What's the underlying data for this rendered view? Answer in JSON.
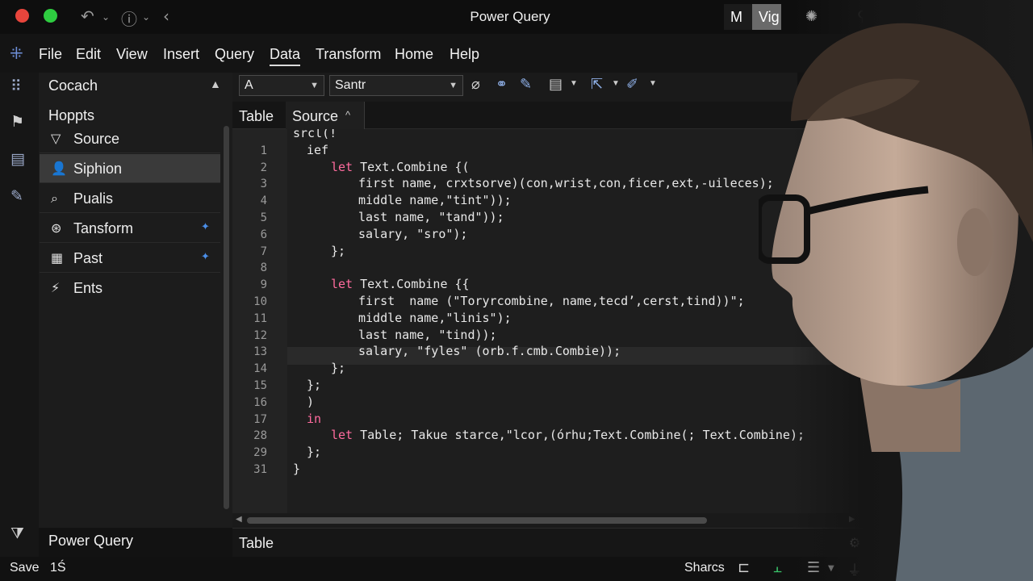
{
  "titlebar": {
    "title": "Power Query",
    "mode_m": "M",
    "mode_v": "Vig"
  },
  "menu": {
    "items": [
      "File",
      "Edit",
      "View",
      "Insert",
      "Query",
      "Data",
      "Transform",
      "Home",
      "Help"
    ],
    "active": "Data"
  },
  "left_panel": {
    "header": "Cocach",
    "subheader": "Hoppts",
    "items": [
      {
        "label": "Source",
        "icon": "filter-icon"
      },
      {
        "label": "Siphion",
        "icon": "user-icon",
        "selected": true
      },
      {
        "label": "Pualis",
        "icon": "search-icon"
      },
      {
        "label": "Tansform",
        "icon": "transform-icon",
        "pinned": true
      },
      {
        "label": "Past",
        "icon": "table-icon",
        "pinned": true
      },
      {
        "label": "Ents",
        "icon": "wand-icon"
      }
    ],
    "footer": "Power Query"
  },
  "toolbar": {
    "font_select": "A",
    "style_select": "Santr"
  },
  "tabs": {
    "table": "Table",
    "source": "Source"
  },
  "editor": {
    "lines": [
      {
        "n": "",
        "indent": 0,
        "text": "srcl(!"
      },
      {
        "n": "1",
        "indent": 1,
        "text": "ief"
      },
      {
        "n": "2",
        "indent": 2,
        "kw": "let",
        "text": " Text.Combine {("
      },
      {
        "n": "3",
        "indent": 3,
        "text": "first name, crxtsorve)(con,wrist,con,ficer,ext,-uileces);"
      },
      {
        "n": "4",
        "indent": 3,
        "text": "middle name,\"tint\"));"
      },
      {
        "n": "5",
        "indent": 3,
        "text": "last name, \"tand\"));"
      },
      {
        "n": "6",
        "indent": 3,
        "text": "salary, \"sro\");"
      },
      {
        "n": "7",
        "indent": 2,
        "text": "};"
      },
      {
        "n": "8",
        "indent": 0,
        "text": ""
      },
      {
        "n": "9",
        "indent": 2,
        "kw": "let",
        "text": " Text.Combine {{"
      },
      {
        "n": "10",
        "indent": 3,
        "text": "first  name (\"Toryrcombine, name,tecd’,cerst,tind))\";"
      },
      {
        "n": "11",
        "indent": 3,
        "text": "middle name,\"linis\");"
      },
      {
        "n": "12",
        "indent": 3,
        "text": "last name, \"tind));"
      },
      {
        "n": "13",
        "indent": 3,
        "text": "salary, \"fyles\" (orb.f.cmb.Combie));"
      },
      {
        "n": "14",
        "indent": 2,
        "text": "};"
      },
      {
        "n": "15",
        "indent": 1,
        "text": "};"
      },
      {
        "n": "16",
        "indent": 1,
        "text": ")"
      },
      {
        "n": "17",
        "indent": 1,
        "kw": "in",
        "text": ""
      },
      {
        "n": "28",
        "indent": 2,
        "kw": "let",
        "text": " Table; Takue starce,\"lcor,(órhu;Text.Combine(; Text.Combine);"
      },
      {
        "n": "29",
        "indent": 1,
        "text": "};"
      },
      {
        "n": "31",
        "indent": 0,
        "text": "}"
      }
    ]
  },
  "bottom": {
    "table_tab": "Table"
  },
  "statusbar": {
    "save": "Save",
    "count": "1Ś",
    "share": "Sharcs",
    "zoom_fraction": 0.6
  }
}
